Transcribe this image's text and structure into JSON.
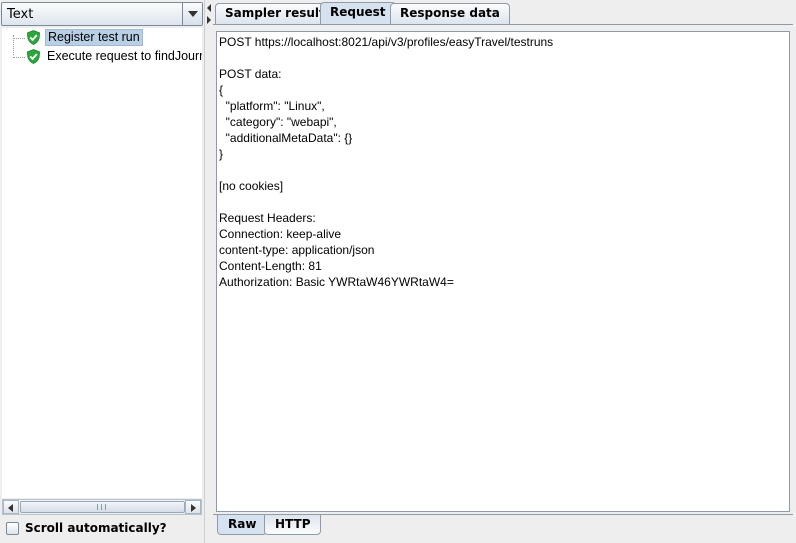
{
  "left_panel": {
    "view_selector": {
      "value": "Text"
    },
    "tree_items": [
      {
        "label": "Register test run",
        "status": "success",
        "selected": true
      },
      {
        "label": "Execute request to findJourn",
        "status": "success",
        "selected": false
      }
    ],
    "scroll_auto_label": "Scroll automatically?",
    "scroll_auto_checked": false
  },
  "top_tabs": [
    "Sampler result",
    "Request",
    "Response data"
  ],
  "active_top_tab": "Request",
  "request": {
    "lines": [
      "POST https://localhost:8021/api/v3/profiles/easyTravel/testruns",
      "",
      "POST data:",
      "{",
      "  \"platform\": \"Linux\",",
      "  \"category\": \"webapi\",",
      "  \"additionalMetaData\": {}",
      "}",
      "",
      "[no cookies]",
      "",
      "Request Headers:",
      "Connection: keep-alive",
      "content-type: application/json",
      "Content-Length: 81",
      "Authorization: Basic YWRtaW46YWRtaW4="
    ]
  },
  "bottom_tabs": [
    "Raw",
    "HTTP"
  ],
  "active_bottom_tab": "Raw",
  "colors": {
    "selection": "#b8cfe5",
    "check_green": "#2aa83a",
    "active_tab": "#d6e2ef"
  }
}
